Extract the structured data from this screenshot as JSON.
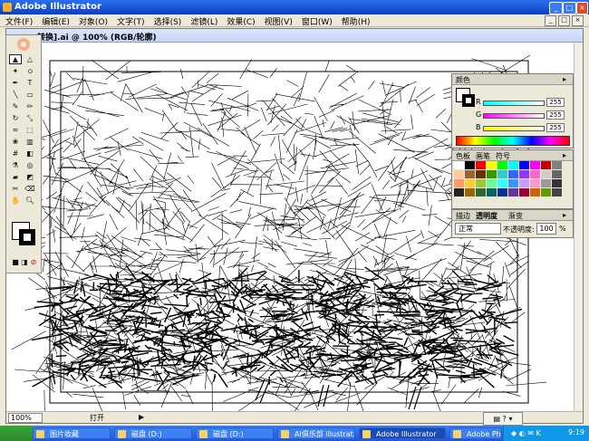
{
  "window": {
    "title": "Adobe Illustrator"
  },
  "menubar": {
    "items": [
      "文件(F)",
      "编辑(E)",
      "对象(O)",
      "文字(T)",
      "选择(S)",
      "滤镜(L)",
      "效果(C)",
      "视图(V)",
      "窗口(W)",
      "帮助(H)"
    ]
  },
  "document": {
    "title": "转换].ai @ 100% (RGB/轮廓)",
    "zoom": "100%",
    "status": "打开"
  },
  "color_panel": {
    "tab": "颜色",
    "r": {
      "label": "R",
      "value": "255"
    },
    "g": {
      "label": "G",
      "value": "255"
    },
    "b": {
      "label": "B",
      "value": "255"
    }
  },
  "swatch_panel": {
    "tabs": [
      "色板",
      "画笔",
      "符号"
    ]
  },
  "transparency_panel": {
    "tabs": [
      "描边",
      "透明度",
      "渐变"
    ],
    "mode": "正常",
    "opacity_label": "不透明度:",
    "opacity_value": "100",
    "opacity_unit": "%"
  },
  "taskbar": {
    "tasks": [
      {
        "label": "图片收藏"
      },
      {
        "label": "磁盘 (D:)"
      },
      {
        "label": "磁盘 (D:)"
      },
      {
        "label": "AI俱乐部 illustrat..."
      },
      {
        "label": "Adobe Illustrator"
      },
      {
        "label": "Adobe Photoshop"
      }
    ],
    "clock": "9:19"
  },
  "colors": {
    "xp_blue": "#245edb",
    "tray": "#0f97e8",
    "panel": "#ece9d8"
  }
}
